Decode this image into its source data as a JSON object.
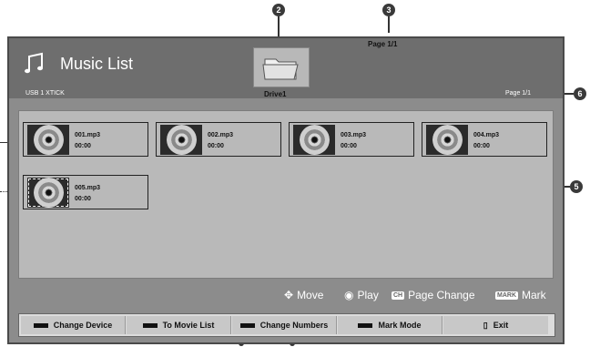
{
  "header": {
    "title": "Music List",
    "device": "USB 1 XTICK",
    "drive_label": "Drive1",
    "page_top": "Page 1/1",
    "page_right": "Page 1/1"
  },
  "files": [
    {
      "name": "001.mp3",
      "time": "00:00"
    },
    {
      "name": "002.mp3",
      "time": "00:00"
    },
    {
      "name": "003.mp3",
      "time": "00:00"
    },
    {
      "name": "004.mp3",
      "time": "00:00"
    },
    {
      "name": "005.mp3",
      "time": "00:00"
    }
  ],
  "hints": {
    "move": "Move",
    "play": "Play",
    "page_change_chip": "CH",
    "page_change": "Page Change",
    "mark_chip": "MARK",
    "mark": "Mark"
  },
  "footer": {
    "buttons": [
      {
        "label": "Change Device"
      },
      {
        "label": "To Movie List"
      },
      {
        "label": "Change Numbers"
      },
      {
        "label": "Mark Mode"
      },
      {
        "label": "Exit"
      }
    ]
  },
  "callouts": [
    "2",
    "3",
    "5",
    "6"
  ]
}
